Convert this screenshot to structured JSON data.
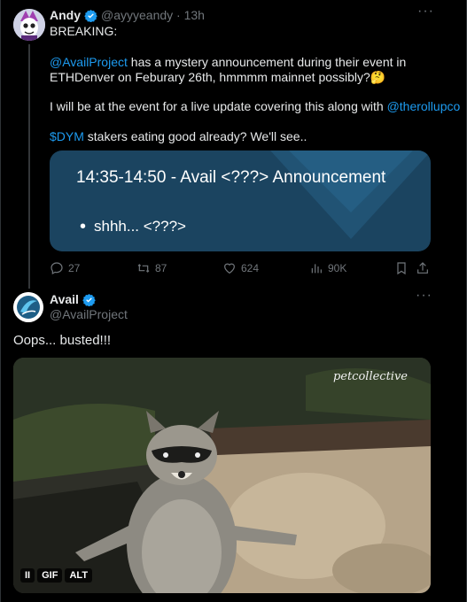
{
  "tweet1": {
    "author_name": "Andy",
    "handle": "@ayyyeandy",
    "time": "13h",
    "line_breaking": "BREAKING:",
    "mention_avail": "@AvailProject",
    "line2_rest": " has a mystery announcement during their event in",
    "line3": "ETHDenver on Feburary 26th, hmmmm mainnet possibly?",
    "emoji": "🤔",
    "line4": "I will be at the event for a live update covering this along with ",
    "mention_rollup": "@therollupco",
    "cashtag": "$DYM",
    "line5_rest": " stakers eating good already? We'll see..",
    "card_title": "14:35-14:50 - Avail <???> Announcement",
    "card_bullet": "shhh... <???>",
    "replies": "27",
    "retweets": "87",
    "likes": "624",
    "views": "90K"
  },
  "tweet2": {
    "author_name": "Avail",
    "handle": "@AvailProject",
    "text": "Oops... busted!!!",
    "watermark": "petcollective",
    "pause_label": "II",
    "gif_label": "GIF",
    "alt_label": "ALT"
  },
  "colors": {
    "background": "#000000",
    "link": "#1d9bf0",
    "muted": "#71767b",
    "card": "#1b4460"
  }
}
